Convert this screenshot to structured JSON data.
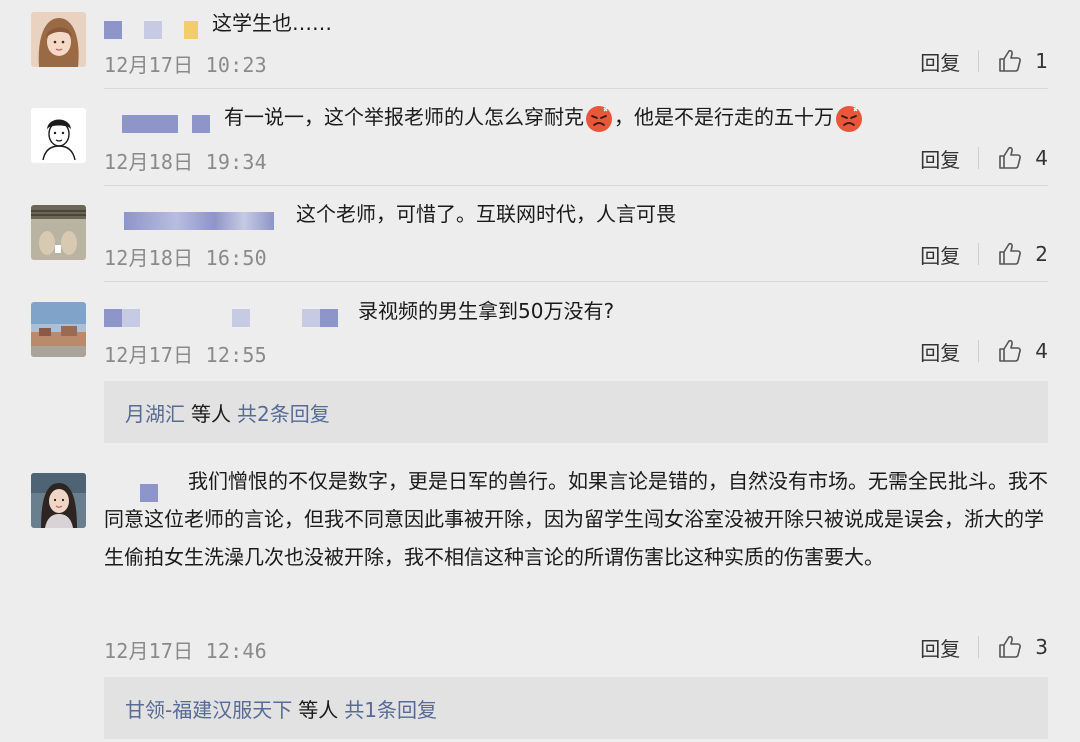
{
  "comments": [
    {
      "text": "这学生也……",
      "time": "12月17日 10:23",
      "reply_label": "回复",
      "likes": "1"
    },
    {
      "text_part1": "有一说一，这个举报老师的人怎么穿耐克",
      "text_part2": "，他是不是行走的五十万",
      "emoji": "angry-face",
      "time": "12月18日 19:34",
      "reply_label": "回复",
      "likes": "4"
    },
    {
      "text": "这个老师，可惜了。互联网时代，人言可畏",
      "time": "12月18日 16:50",
      "reply_label": "回复",
      "likes": "2"
    },
    {
      "text": "录视频的男生拿到50万没有?",
      "time": "12月17日 12:55",
      "reply_label": "回复",
      "likes": "4",
      "replies": {
        "names": "月湖汇",
        "mid": "等人",
        "count": "共2条回复"
      }
    },
    {
      "text": "我们憎恨的不仅是数字，更是日军的兽行。如果言论是错的，自然没有市场。无需全民批斗。我不同意这位老师的言论，但我不同意因此事被开除，因为留学生闯女浴室没被开除只被说成是误会，浙大的学生偷拍女生洗澡几次也没被开除，我不相信这种言论的所谓伤害比这种实质的伤害要大。",
      "time": "12月17日 12:46",
      "reply_label": "回复",
      "likes": "3",
      "replies": {
        "names": "甘领-福建汉服天下",
        "mid": "等人",
        "count": "共1条回复"
      }
    }
  ],
  "colors": {
    "background": "#ededed",
    "link": "#576b95",
    "time": "#8a8a8a",
    "reply_box": "#e2e2e2",
    "name_block": "#8e95c8"
  },
  "icons": {
    "like": "thumbs-up-icon",
    "emoji": "angry-face-emoji"
  }
}
